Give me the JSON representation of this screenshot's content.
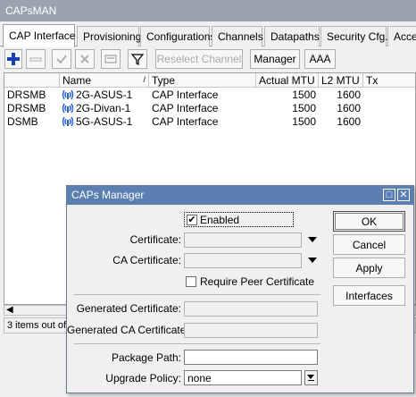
{
  "window": {
    "title": "CAPsMAN"
  },
  "tabs": [
    {
      "label": "CAP Interface",
      "active": true
    },
    {
      "label": "Provisioning"
    },
    {
      "label": "Configurations"
    },
    {
      "label": "Channels"
    },
    {
      "label": "Datapaths"
    },
    {
      "label": "Security Cfg."
    },
    {
      "label": "Acces"
    }
  ],
  "toolbar": {
    "add_icon": "plus-icon",
    "remove_icon": "minus-icon",
    "enable_icon": "check-icon",
    "disable_icon": "x-icon",
    "comment_icon": "comment-icon",
    "filter_icon": "filter-icon",
    "reselect_label": "Reselect Channel",
    "manager_label": "Manager",
    "aaa_label": "AAA"
  },
  "table": {
    "columns": [
      "",
      "Name",
      "Type",
      "Actual MTU",
      "L2 MTU",
      "Tx"
    ],
    "rows": [
      {
        "flag": "DRSMB",
        "name": "2G-ASUS-1",
        "type": "CAP Interface",
        "actual_mtu": "1500",
        "l2_mtu": "1600"
      },
      {
        "flag": "DRSMB",
        "name": "2G-Divan-1",
        "type": "CAP Interface",
        "actual_mtu": "1500",
        "l2_mtu": "1600"
      },
      {
        "flag": "DSMB",
        "name": "5G-ASUS-1",
        "type": "CAP Interface",
        "actual_mtu": "1500",
        "l2_mtu": "1600"
      }
    ]
  },
  "status": {
    "text": "3 items out of"
  },
  "dialog": {
    "title": "CAPs Manager",
    "enabled_label": "Enabled",
    "enabled": true,
    "certificate_label": "Certificate:",
    "certificate_value": "",
    "ca_certificate_label": "CA Certificate:",
    "ca_certificate_value": "",
    "require_peer_label": "Require Peer Certificate",
    "generated_cert_label": "Generated Certificate:",
    "generated_ca_label": "Generated CA Certificate:",
    "package_path_label": "Package Path:",
    "package_path_value": "",
    "upgrade_policy_label": "Upgrade Policy:",
    "upgrade_policy_value": "none",
    "ok_label": "OK",
    "cancel_label": "Cancel",
    "apply_label": "Apply",
    "interfaces_label": "Interfaces"
  },
  "colors": {
    "titlebar": "#9aa4b0",
    "dialog_title": "#5a7fb0",
    "add_icon": "#1a3fb5",
    "wifi_icon": "#2a62c9"
  }
}
